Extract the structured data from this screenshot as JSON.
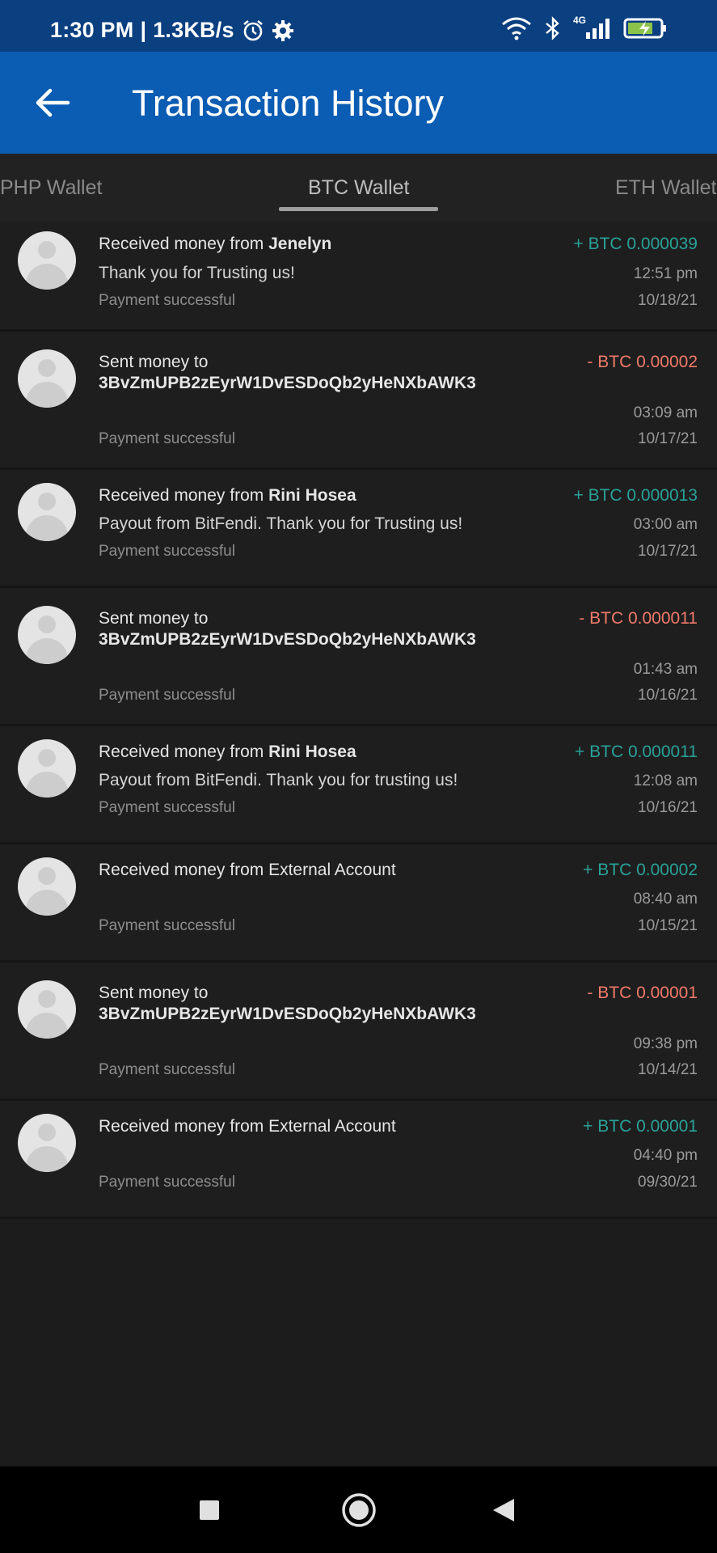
{
  "status_bar": {
    "time": "1:30 PM",
    "separator": "|",
    "speed": "1.3KB/s",
    "network": "4G"
  },
  "header": {
    "title": "Transaction History"
  },
  "tabs": [
    {
      "label": "PHP Wallet"
    },
    {
      "label": "BTC Wallet"
    },
    {
      "label": "ETH Wallet"
    }
  ],
  "transactions": [
    {
      "prefix": "Received money from ",
      "name": "Jenelyn",
      "message": "Thank you for Trusting us!",
      "amount": "+ BTC 0.000039",
      "time": "12:51 pm",
      "date": "10/18/21",
      "status": "Payment successful"
    },
    {
      "prefix": "Sent money to",
      "name": "3BvZmUPB2zEyrW1DvESDoQb2yHeNXbAWK3",
      "message": "",
      "amount": "- BTC 0.00002",
      "time": "03:09 am",
      "date": "10/17/21",
      "status": "Payment successful"
    },
    {
      "prefix": "Received money from ",
      "name": "Rini Hosea",
      "message": "Payout from BitFendi. Thank you for Trusting us!",
      "amount": "+ BTC 0.000013",
      "time": "03:00 am",
      "date": "10/17/21",
      "status": "Payment successful"
    },
    {
      "prefix": "Sent money to",
      "name": "3BvZmUPB2zEyrW1DvESDoQb2yHeNXbAWK3",
      "message": "",
      "amount": "- BTC 0.000011",
      "time": "01:43 am",
      "date": "10/16/21",
      "status": "Payment successful"
    },
    {
      "prefix": "Received money from ",
      "name": "Rini Hosea",
      "message": "Payout from BitFendi. Thank you for trusting us!",
      "amount": "+ BTC 0.000011",
      "time": "12:08 am",
      "date": "10/16/21",
      "status": "Payment successful"
    },
    {
      "prefix": "Received money from External Account",
      "name": "",
      "message": "",
      "amount": "+ BTC 0.00002",
      "time": "08:40 am",
      "date": "10/15/21",
      "status": "Payment successful"
    },
    {
      "prefix": "Sent money to",
      "name": "3BvZmUPB2zEyrW1DvESDoQb2yHeNXbAWK3",
      "message": "",
      "amount": "- BTC 0.00001",
      "time": "09:38 pm",
      "date": "10/14/21",
      "status": "Payment successful"
    },
    {
      "prefix": "Received money from External Account",
      "name": "",
      "message": "",
      "amount": "+ BTC 0.00001",
      "time": "04:40 pm",
      "date": "09/30/21",
      "status": "Payment successful"
    }
  ],
  "colors": {
    "status_bar": "#0a3f80",
    "app_bar": "#0b5cb3",
    "incoming": "#2aa198",
    "outgoing": "#f07a6a",
    "background": "#1c1c1c"
  },
  "icons": [
    "alarm-icon",
    "settings-icon",
    "wifi-icon",
    "bluetooth-icon",
    "signal-icon",
    "battery-charging-icon",
    "back-arrow-icon",
    "avatar-icon",
    "recents-icon",
    "home-icon",
    "nav-back-icon"
  ]
}
